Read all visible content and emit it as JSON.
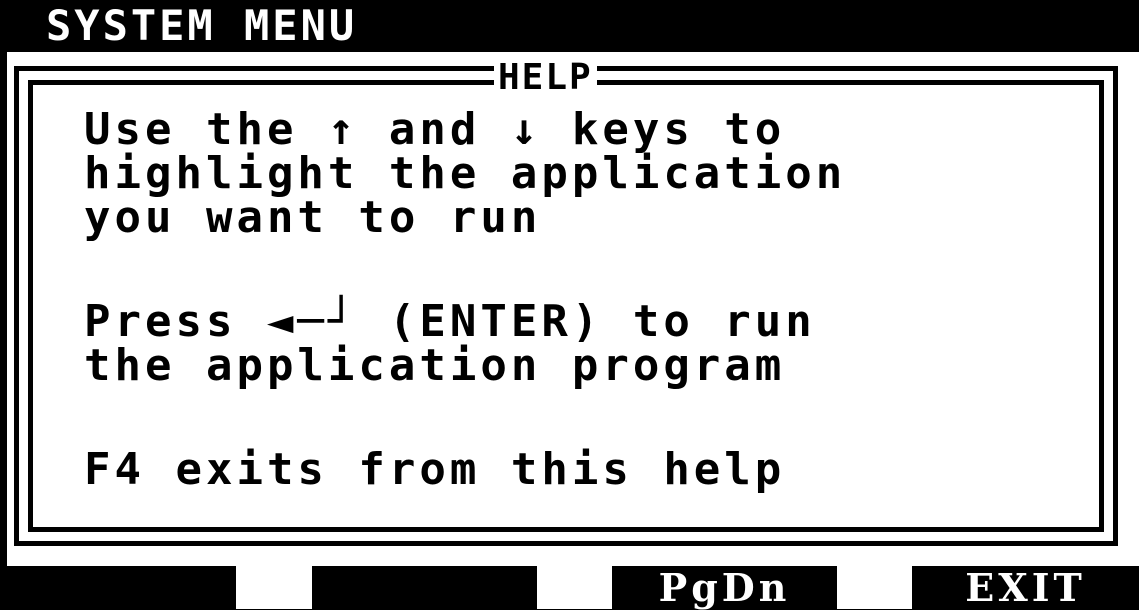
{
  "titlebar": {
    "title": "SYSTEM MENU"
  },
  "help_window": {
    "title": "HELP",
    "lines": [
      "Use the ↑ and ↓ keys to",
      "highlight the application",
      "you want to run",
      "",
      "Press ◄─┘ (ENTER) to run",
      "the application program",
      "",
      "F4 exits from this help"
    ]
  },
  "function_keys": [
    {
      "label": ""
    },
    {
      "label": ""
    },
    {
      "label": "PgDn"
    },
    {
      "label": "EXIT"
    }
  ],
  "colors": {
    "background": "#000000",
    "panel": "#ffffff",
    "text_dark": "#000000",
    "text_light": "#ffffff"
  }
}
